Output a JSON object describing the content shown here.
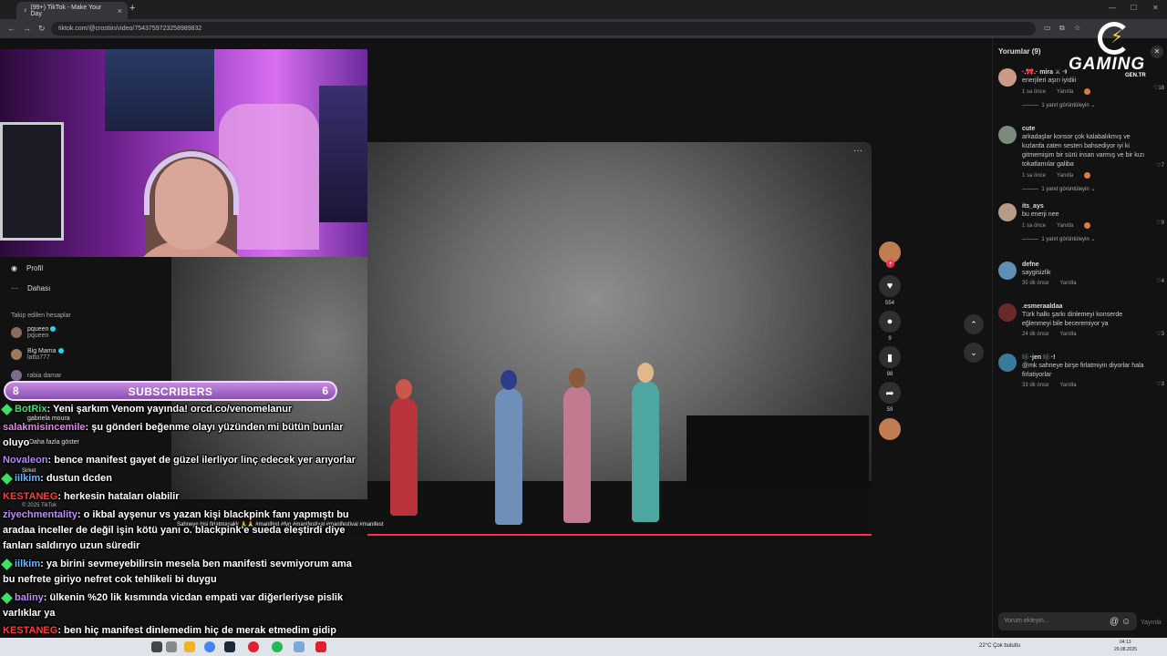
{
  "browser": {
    "tab_title": "(99+) TikTok - Make Your Day",
    "url": "tiktok.com/@crostiin/video/7543759723258989832"
  },
  "sidebar": {
    "items": [
      {
        "label": "Profil"
      },
      {
        "label": "Dahası"
      }
    ],
    "followed_heading": "Takip edilen hesaplar",
    "followed": [
      {
        "name": "pqueen",
        "handle": "pqueen"
      },
      {
        "name": "Big Mama",
        "handle": "latto777"
      },
      {
        "name": "rabia damar",
        "handle": ""
      },
      {
        "name": "gabriela moura",
        "handle": ""
      }
    ],
    "more_label": "Daha fazla göster",
    "company_label": "Şirket",
    "copyright": "© 2025 TikTok"
  },
  "video": {
    "caption": "Sahneye bisi firlatmasakk 🙏🙏 #manifest #fyp #manifestival #manifestival #manifest",
    "more": "···"
  },
  "actions": {
    "like_count": "554",
    "comment_count": "9",
    "save_count": "98",
    "share_count": "59"
  },
  "comments": {
    "title": "Yorumlar (9)",
    "items": [
      {
        "user": "·.🎀.· mira ⚔ ·ᵍ",
        "text": "enerjileri aşırı iyidiii",
        "time": "1 sa önce",
        "reply": "Yanıtla",
        "likes": "18",
        "replies": "1 yanıt görüntüleyin",
        "color": "#c99b86"
      },
      {
        "user": "cute",
        "text": "arkadaşlar konsor çok kalabalıkmış ve kızlarda zaten sesten bahsediyor iyi ki gitmemişim bir sürü insan varmış ve bir kızı tokatlamılar galiba",
        "time": "1 sa önce",
        "reply": "Yanıtla",
        "likes": "7",
        "replies": "1 yanıt görüntüleyin",
        "color": "#7a8b7a"
      },
      {
        "user": "its_ays",
        "text": "bu enerji nee",
        "time": "1 sa önce",
        "reply": "Yanıtla",
        "likes": "9",
        "replies": "1 yanıt görüntüleyin",
        "color": "#b89a88"
      },
      {
        "user": "defne",
        "text": "saygisizlik",
        "time": "35 dk önce",
        "reply": "Yanıtla",
        "likes": "4",
        "replies": "",
        "color": "#5f8fb5"
      },
      {
        "user": ".esmeraaldaa",
        "text": "Türk halkı şarkı dinlemeyi konserde eğlenmeyi bile beceremiyor ya",
        "time": "24 dk önce",
        "reply": "Yanıtla",
        "likes": "3",
        "replies": "",
        "color": "#6b2a2a"
      },
      {
        "user": "🎼·jen 🎼·!",
        "text": "@mk sahneye birşe firlatmiyin diyorlar hala firlatiyorlar",
        "time": "33 dk önce",
        "reply": "Yanıtla",
        "likes": "3",
        "replies": "",
        "color": "#3a7a9a"
      }
    ],
    "input_placeholder": "Yorum ekleyin...",
    "post_label": "Yayınla"
  },
  "logo": {
    "word": "GAMING",
    "sub": "GEN.TR"
  },
  "subscribers": {
    "label": "SUBSCRIBERS",
    "left": "8",
    "right": "6"
  },
  "chat": [
    {
      "name": "BotRix",
      "name_color": "#3ee066",
      "badge": true,
      "text": ": Yeni şarkım Venom yayında! orcd.co/venomelanur"
    },
    {
      "name": "salakmisincemile",
      "name_color": "#e08be0",
      "badge": false,
      "text": ": şu gönderi beğenme olayı yüzünden mi bütün bunlar oluyo"
    },
    {
      "name": "Novaleon",
      "name_color": "#b38bff",
      "badge": false,
      "text": ": bence manifest gayet de güzel ilerliyor linç edecek yer arıyorlar"
    },
    {
      "name": "iilkim",
      "name_color": "#6bb8ff",
      "badge": true,
      "text": ": dustun dcden"
    },
    {
      "name": "KESTANEG",
      "name_color": "#ff3b3b",
      "badge": false,
      "text": ": herkesin hataları olabilir"
    },
    {
      "name": "ziyechmentality",
      "name_color": "#c48bff",
      "badge": false,
      "text": ": o ikbal ayşenur vs yazan kişi blackpink fanı yapmıştı bu aradaa inceller de değil işin kötü yanı o. blackpink'e sueda eleştirdi diye fanları saldırıyo uzun süredir"
    },
    {
      "name": "iilkim",
      "name_color": "#6bb8ff",
      "badge": true,
      "text": ": ya birini sevmeyebilirsin mesela ben manifesti sevmiyorum ama bu nefrete giriyo nefret cok tehlikeli bi duygu"
    },
    {
      "name": "baliny",
      "name_color": "#c48bff",
      "badge": true,
      "text": ": ülkenin %20 lik kısmında vicdan empati var diğerleriyse pislik varlıklar ya"
    },
    {
      "name": "KESTANEG",
      "name_color": "#ff3b3b",
      "badge": false,
      "text": ": ben hiç manifest dinlemedim hiç de merak etmedim gidip arkasından da sallamadım"
    }
  ],
  "taskbar": {
    "weather": "22°C  Çok bulutlu",
    "time": "04:13",
    "date": "29.08.2025"
  }
}
